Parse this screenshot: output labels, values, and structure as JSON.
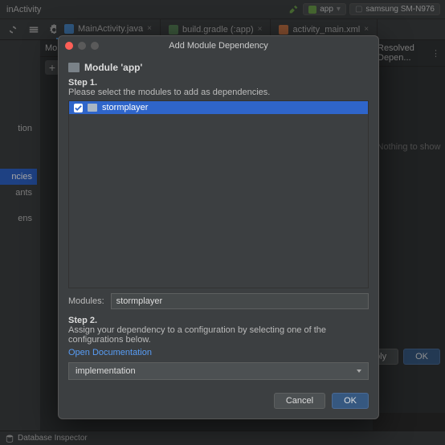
{
  "breadcrumb": "inActivity",
  "runConfig": {
    "app": "app",
    "device": "samsung SM-N976"
  },
  "tabs": [
    {
      "label": "MainActivity.java",
      "type": "java",
      "active": true
    },
    {
      "label": "build.gradle (:app)",
      "type": "gradle",
      "active": false
    },
    {
      "label": "activity_main.xml",
      "type": "xml",
      "active": false
    }
  ],
  "sidebar": {
    "items": [
      "tion",
      "ncies",
      "ants",
      "ens"
    ],
    "selected": 1
  },
  "midPanel": {
    "head": "Mo"
  },
  "rightPanel": {
    "head": "Resolved Depen...",
    "empty": "Nothing to show"
  },
  "buttons": {
    "apply": "Apply",
    "ok": "OK"
  },
  "status": {
    "db": "Database Inspector"
  },
  "modal": {
    "title": "Add Module Dependency",
    "moduleHead": "Module 'app'",
    "step1": "Step 1.",
    "step1sub": "Please select the modules to add as dependencies.",
    "listItem": "stormplayer",
    "modulesLabel": "Modules:",
    "modulesValue": "stormplayer",
    "step2": "Step 2.",
    "step2sub": "Assign your dependency to a configuration by selecting one of the configurations below.",
    "docLink": "Open Documentation",
    "scope": "implementation",
    "cancel": "Cancel",
    "ok": "OK"
  }
}
